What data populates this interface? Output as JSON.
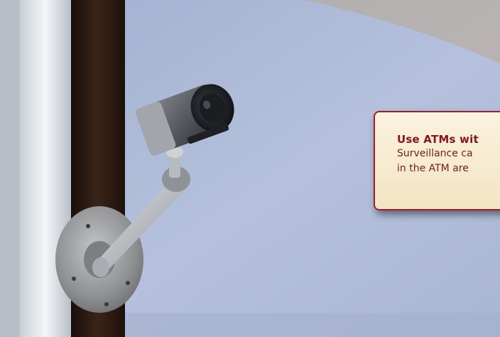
{
  "callout": {
    "title": "Use ATMs wit",
    "body_lines": [
      "Surveillance ca",
      "in the ATM are"
    ],
    "border_color": "#9c1f2b",
    "title_color": "#8a1424",
    "text_color": "#7a1c1f",
    "background_color": "#f5e7c8"
  },
  "photo": {
    "subject": "surveillance-camera-on-mount",
    "sky_color": "#aebbd8",
    "post_color": "#2a1a12"
  }
}
